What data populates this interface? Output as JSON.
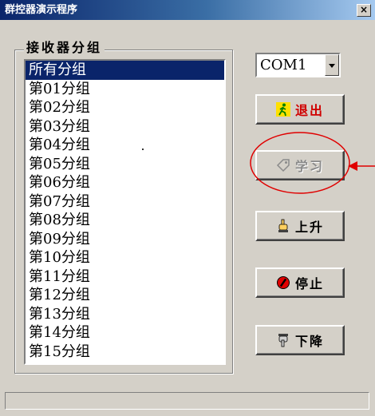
{
  "window": {
    "title": "群控器演示程序",
    "close_label": "×"
  },
  "group": {
    "label": "接收器分组"
  },
  "list": {
    "items": [
      "所有分组",
      "第01分组",
      "第02分组",
      "第03分组",
      "第04分组",
      "第05分组",
      "第06分组",
      "第07分组",
      "第08分组",
      "第09分组",
      "第10分组",
      "第11分组",
      "第12分组",
      "第13分组",
      "第14分组",
      "第15分组"
    ],
    "selected_index": 0
  },
  "combo": {
    "value": "COM1"
  },
  "buttons": {
    "exit": {
      "label": "退出",
      "icon": "running-man-icon"
    },
    "learn": {
      "label": "学习",
      "icon": "tag-icon",
      "enabled": false
    },
    "up": {
      "label": "上升",
      "icon": "hand-up-icon"
    },
    "stop": {
      "label": "停止",
      "icon": "stop-icon"
    },
    "down": {
      "label": "下降",
      "icon": "hand-down-icon"
    }
  },
  "annotation": {
    "color": "#e00000"
  }
}
